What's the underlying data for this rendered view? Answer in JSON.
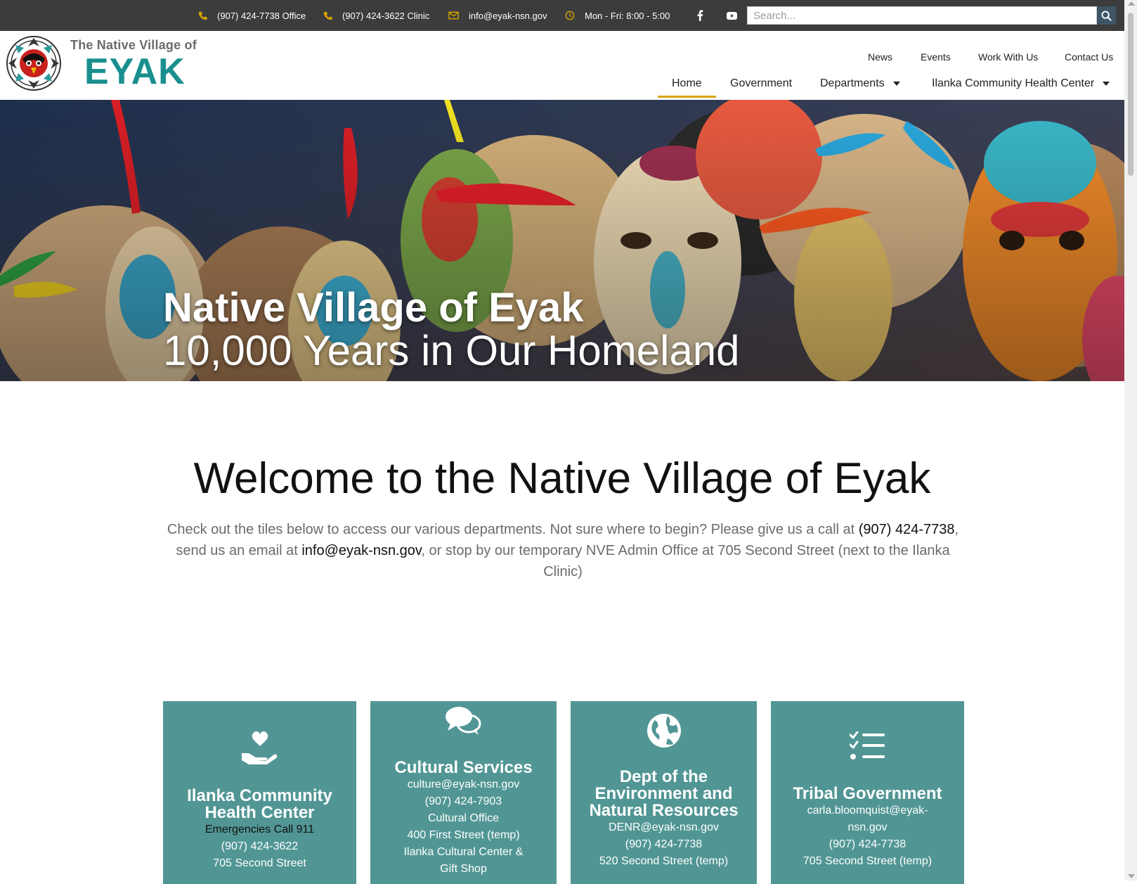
{
  "topbar": {
    "office_phone": "(907) 424-7738 Office",
    "clinic_phone": "(907) 424-3622 Clinic",
    "email": "info@eyak-nsn.gov",
    "hours": "Mon - Fri: 8:00 - 5:00",
    "search_placeholder": "Search...",
    "icon_color": "#d9a400"
  },
  "logo": {
    "top_text": "The Native Village of",
    "main_text": "EYAK"
  },
  "utility_nav": [
    "News",
    "Events",
    "Work With Us",
    "Contact Us"
  ],
  "main_nav": {
    "home": "Home",
    "government": "Government",
    "departments": "Departments",
    "health": "Ilanka Community Health Center"
  },
  "hero": {
    "title": "Native Village of Eyak",
    "subtitle": "10,000 Years in Our Homeland"
  },
  "welcome": {
    "heading": "Welcome to the Native Village of Eyak",
    "p1": "Check out the tiles below to access our various departments. Not sure where to begin? Please give us a call at ",
    "phone": "(907) 424-7738",
    "p2": ", send us an email at ",
    "email": "info@eyak-nsn.gov",
    "p3": ", or stop by our temporary NVE Admin Office at 705 Second Street (next to the Ilanka Clinic)"
  },
  "tiles": [
    {
      "icon": "hand-heart-icon",
      "title": "Ilanka Community Health Center",
      "emergency_a": "Emergencies",
      "emergency_b": " Call 911",
      "phone": "(907) 424-3622",
      "address": "705 Second Street"
    },
    {
      "icon": "chat-bubbles-icon",
      "title": "Cultural Services",
      "email": "culture@eyak-nsn.gov",
      "phone": "(907) 424-7903",
      "office": "Cultural Office",
      "address": "400 First Street (temp)",
      "center": "Ilanka Cultural Center &",
      "shop": "Gift Shop"
    },
    {
      "icon": "globe-icon",
      "title": "Dept of the Environment and Natural Resources",
      "email": "DENR@eyak-nsn.gov",
      "phone": "(907) 424-7738",
      "address": "520 Second Street (temp)"
    },
    {
      "icon": "checklist-icon",
      "title": "Tribal Government",
      "email_a": "carla.bloomquist@eyak-",
      "email_b": "nsn.gov",
      "phone": "(907) 424-7738",
      "address": "705 Second Street (temp)"
    }
  ],
  "colors": {
    "topbar_bg": "#3c3c3c",
    "accent_gold": "#d9a400",
    "brand_teal": "#1a8f8f",
    "tile_teal": "#519694"
  }
}
